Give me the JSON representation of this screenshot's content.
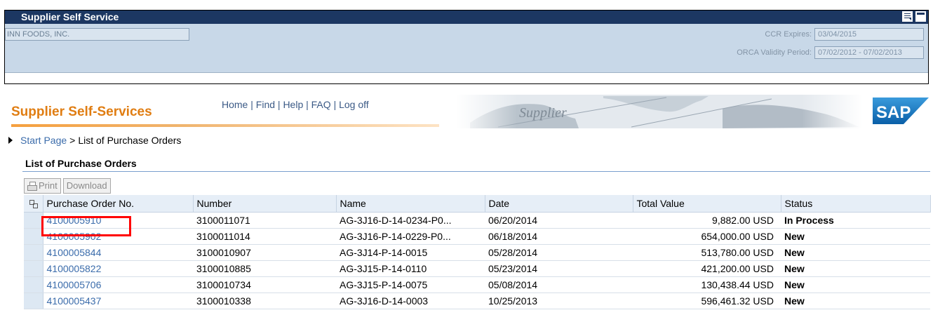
{
  "topbar": {
    "title": "Supplier Self Service"
  },
  "vendor": {
    "name": "INN FOODS, INC."
  },
  "ccr": {
    "label": "CCR Expires:",
    "value": "03/04/2015"
  },
  "orca": {
    "label": "ORCA Validity Period:",
    "value": "07/02/2012 - 07/02/2013"
  },
  "brand": {
    "title": "Supplier Self-Services"
  },
  "nav": {
    "home": "Home",
    "find": "Find",
    "help": "Help",
    "faq": "FAQ",
    "logoff": "Log off",
    "sep": "|"
  },
  "breadcrumb": {
    "start": "Start Page",
    "gt": ">",
    "current": "List of Purchase Orders"
  },
  "section": {
    "title": "List of Purchase Orders"
  },
  "toolbar": {
    "print": "Print",
    "download": "Download"
  },
  "table": {
    "headers": [
      "Purchase Order No.",
      "Number",
      "Name",
      "Date",
      "Total Value",
      "Status"
    ],
    "rows": [
      {
        "po": "4100005910",
        "number": "3100011071",
        "name": "AG-3J16-D-14-0234-P0...",
        "date": "06/20/2014",
        "value": "9,882.00 USD",
        "status": "In Process"
      },
      {
        "po": "4100005902",
        "number": "3100011014",
        "name": "AG-3J16-P-14-0229-P0...",
        "date": "06/18/2014",
        "value": "654,000.00 USD",
        "status": "New"
      },
      {
        "po": "4100005844",
        "number": "3100010907",
        "name": "AG-3J14-P-14-0015",
        "date": "05/28/2014",
        "value": "513,780.00 USD",
        "status": "New"
      },
      {
        "po": "4100005822",
        "number": "3100010885",
        "name": "AG-3J15-P-14-0110",
        "date": "05/23/2014",
        "value": "421,200.00 USD",
        "status": "New"
      },
      {
        "po": "4100005706",
        "number": "3100010734",
        "name": "AG-3J15-P-14-0075",
        "date": "05/08/2014",
        "value": "130,438.44 USD",
        "status": "New"
      },
      {
        "po": "4100005437",
        "number": "3100010338",
        "name": "AG-3J16-D-14-0003",
        "date": "10/25/2013",
        "value": "596,461.32 USD",
        "status": "New"
      }
    ]
  },
  "logo": {
    "text": "SAP"
  },
  "colors": {
    "header_bg": "#1c3762",
    "brand_orange": "#e07d12",
    "link": "#3b6cab",
    "highlight": "#ff0000"
  }
}
